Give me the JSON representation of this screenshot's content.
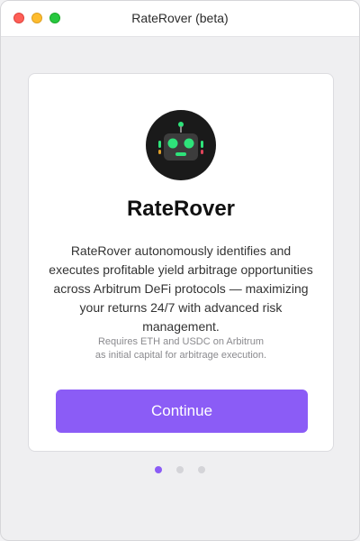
{
  "window": {
    "title": "RateRover (beta)"
  },
  "card": {
    "app_name": "RateRover",
    "description": "RateRover autonomously identifies and executes profitable yield arbitrage opportunities across Arbitrum DeFi protocols — maximizing your returns 24/7 with advanced risk management.",
    "note_line1": "Requires ETH and USDC on Arbitrum",
    "note_line2": "as initial capital for arbitrage execution.",
    "continue_label": "Continue",
    "logo_icon": "robot-icon"
  },
  "pagination": {
    "total": 3,
    "current": 1
  },
  "colors": {
    "accent": "#8b5cf6",
    "robot_eyes": "#2ee37a",
    "robot_body": "#1a1a1a"
  }
}
